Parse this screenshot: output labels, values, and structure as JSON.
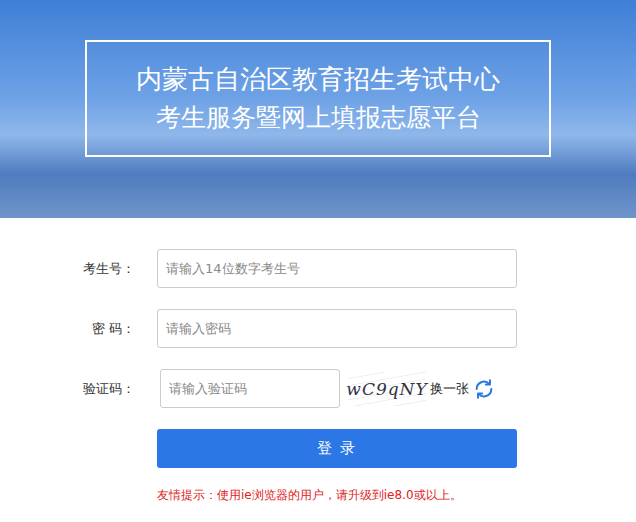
{
  "banner": {
    "title": "内蒙古自治区教育招生考试中心",
    "subtitle": "考生服务暨网上填报志愿平台"
  },
  "fields": [
    {
      "label": "考生号：",
      "placeholder": "请输入14位数字考生号",
      "kind": "text"
    },
    {
      "label": "密 码：",
      "placeholder": "请输入密码",
      "kind": "password"
    }
  ],
  "captcha": {
    "label": "验证码：",
    "placeholder": "请输入验证码",
    "code": "wC9qNY",
    "refresh": "换一张"
  },
  "login_button": "登 录",
  "hint": "友情提示：使用ie浏览器的用户，请升级到ie8.0或以上。"
}
